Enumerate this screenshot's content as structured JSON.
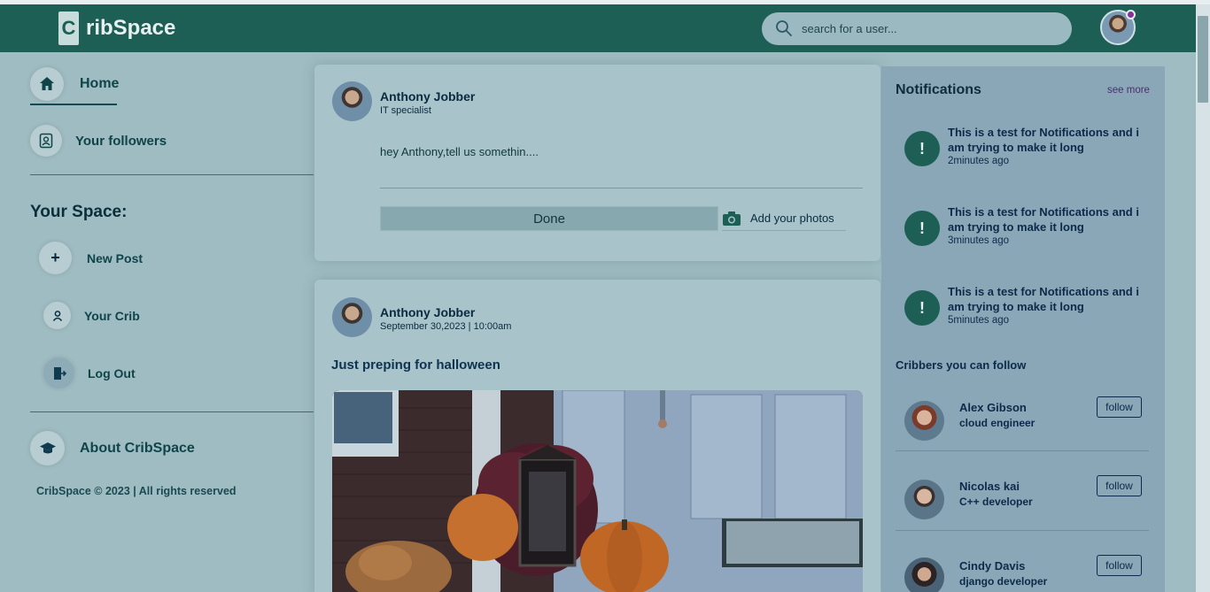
{
  "header": {
    "logo_letter": "C",
    "logo_text": "ribSpace",
    "search_placeholder": "search for a user..."
  },
  "sidebar": {
    "home_label": "Home",
    "followers_label": "Your followers",
    "section_title": "Your Space:",
    "new_post_label": "New Post",
    "your_crib_label": "Your Crib",
    "logout_label": "Log Out",
    "about_label": "About CribSpace",
    "footer": "CribSpace © 2023 | All rights reserved"
  },
  "composer": {
    "user_name": "Anthony Jobber",
    "user_role": "IT specialist",
    "prompt": "hey Anthony,tell us somethin....",
    "done_label": "Done",
    "add_photos_label": "Add your photos"
  },
  "post": {
    "user_name": "Anthony Jobber",
    "timestamp": "September 30,2023 | 10:00am",
    "caption": "Just preping for halloween"
  },
  "notifications": {
    "title": "Notifications",
    "see_more": "see more",
    "items": [
      {
        "icon": "!",
        "text": "This is a test for Notifications and i am trying to make it long",
        "time": "2minutes ago"
      },
      {
        "icon": "!",
        "text": "This is a test for Notifications and i am trying to make it long",
        "time": "3minutes ago"
      },
      {
        "icon": "!",
        "text": "This is a test for Notifications and i am trying to make it long",
        "time": "5minutes ago"
      }
    ]
  },
  "suggestions": {
    "title": "Cribbers you can follow",
    "follow_label": "follow",
    "items": [
      {
        "name": "Alex Gibson",
        "role": "cloud engineer"
      },
      {
        "name": "Nicolas kai",
        "role": "C++ developer"
      },
      {
        "name": "Cindy Davis",
        "role": "django developer"
      }
    ]
  },
  "colors": {
    "header_bg": "#1d5f55",
    "page_bg": "#9fbcc2",
    "panel_bg": "#8aa7b7",
    "accent_dot": "#8a2f9a"
  }
}
